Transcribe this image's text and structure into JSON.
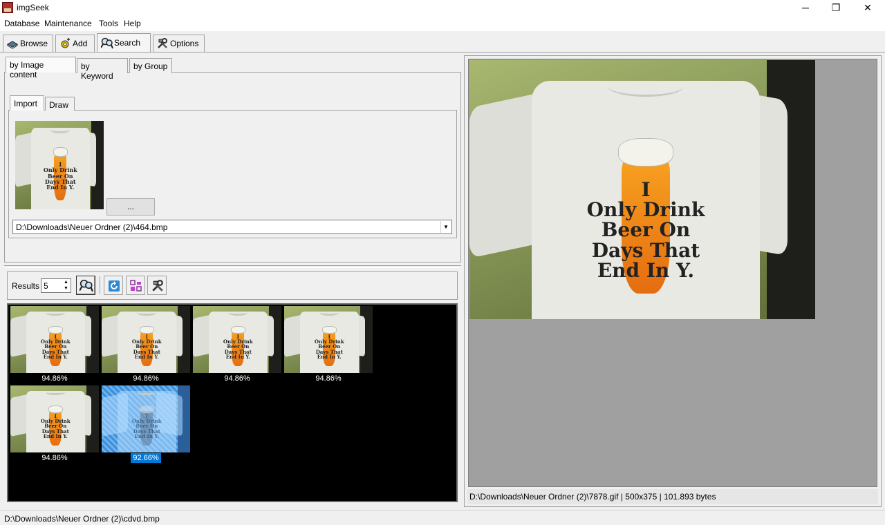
{
  "window": {
    "title": "imgSeek",
    "controls": {
      "minimize": "─",
      "maximize": "❐",
      "close": "✕"
    }
  },
  "menu": [
    "Database",
    "Maintenance",
    "Tools",
    "Help"
  ],
  "main_tabs": [
    {
      "label": "Browse",
      "icon": "book-icon"
    },
    {
      "label": "Add",
      "icon": "add-gear-icon"
    },
    {
      "label": "Search",
      "icon": "search-icon",
      "selected": true
    },
    {
      "label": "Options",
      "icon": "tools-icon"
    }
  ],
  "search_tabs": [
    "by Image content",
    "by Keyword",
    "by Group"
  ],
  "source_tabs": [
    "Import",
    "Draw"
  ],
  "import": {
    "browse_button": "...",
    "path": "D:\\Downloads\\Neuer Ordner (2)\\464.bmp"
  },
  "shirt_text": [
    "I",
    "Only Drink",
    "Beer On",
    "Days That",
    "End In Y."
  ],
  "results": {
    "label": "Results",
    "count": "5",
    "items": [
      {
        "score": "94.86%",
        "selected": false
      },
      {
        "score": "94.86%",
        "selected": false
      },
      {
        "score": "94.86%",
        "selected": false
      },
      {
        "score": "94.86%",
        "selected": false
      },
      {
        "score": "94.86%",
        "selected": false
      },
      {
        "score": "92.66%",
        "selected": true
      }
    ]
  },
  "preview": {
    "info": "D:\\Downloads\\Neuer Ordner (2)\\7878.gif | 500x375 | 101.893 bytes"
  },
  "statusbar": {
    "text": "D:\\Downloads\\Neuer Ordner (2)\\cdvd.bmp"
  },
  "colors": {
    "selection": "#0078d7",
    "results_bg": "#000000",
    "preview_bg": "#a0a0a0"
  }
}
